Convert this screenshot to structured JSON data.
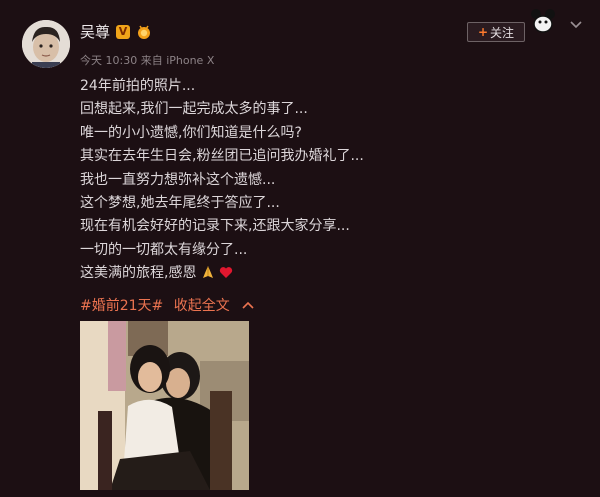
{
  "user": {
    "name": "吴尊"
  },
  "meta": {
    "time": "今天 10:30",
    "source": "来自 iPhone X"
  },
  "follow": {
    "label": "关注"
  },
  "post": {
    "lines": [
      "24年前拍的照片...",
      "回想起来,我们一起完成太多的事了...",
      "唯一的小小遗憾,你们知道是什么吗?",
      "其实在去年生日会,粉丝团已追问我办婚礼了...",
      "我也一直努力想弥补这个遗憾...",
      "这个梦想,她去年尾终于答应了...",
      "现在有机会好好的记录下来,还跟大家分享...",
      "一切的一切都太有缘分了...",
      "这美满的旅程,感恩"
    ],
    "hashtag": "#婚前21天#",
    "collapse_label": "收起全文"
  }
}
